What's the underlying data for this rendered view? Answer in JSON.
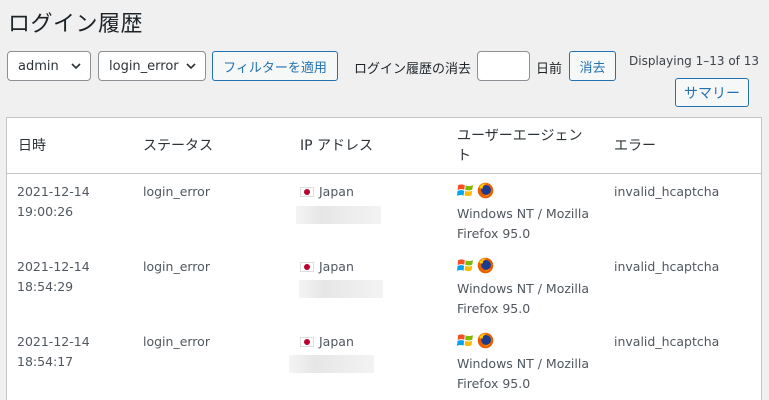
{
  "page": {
    "title": "ログイン履歴"
  },
  "filters": {
    "user_select": "admin",
    "status_select": "login_error",
    "apply_button": "フィルターを適用",
    "purge_label": "ログイン履歴の消去",
    "days_value": "",
    "days_unit": "日前",
    "purge_button": "消去",
    "displaying": "Displaying 1–13 of 13",
    "summary_button": "サマリー"
  },
  "table": {
    "headers": {
      "datetime": "日時",
      "status": "ステータス",
      "ip": "IP アドレス",
      "ua_line1": "ユーザーエージェン",
      "ua_line2": "ト",
      "error": "エラー"
    },
    "rows": [
      {
        "date": "2021-12-14",
        "time": "19:00:26",
        "status": "login_error",
        "country": "Japan",
        "ua_line1": "Windows NT / Mozilla",
        "ua_line2": "Firefox 95.0",
        "error": "invalid_hcaptcha"
      },
      {
        "date": "2021-12-14",
        "time": "18:54:29",
        "status": "login_error",
        "country": "Japan",
        "ua_line1": "Windows NT / Mozilla",
        "ua_line2": "Firefox 95.0",
        "error": "invalid_hcaptcha"
      },
      {
        "date": "2021-12-14",
        "time": "18:54:17",
        "status": "login_error",
        "country": "Japan",
        "ua_line1": "Windows NT / Mozilla",
        "ua_line2": "Firefox 95.0",
        "error": "invalid_hcaptcha"
      }
    ]
  },
  "icons": {
    "os": "windows-icon",
    "browser": "firefox-icon",
    "country_flag": "japan-flag-icon",
    "dropdown": "chevron-down-icon"
  },
  "colors": {
    "accent": "#2271b1",
    "background": "#f0f0f1",
    "flag_red": "#bc002d"
  }
}
